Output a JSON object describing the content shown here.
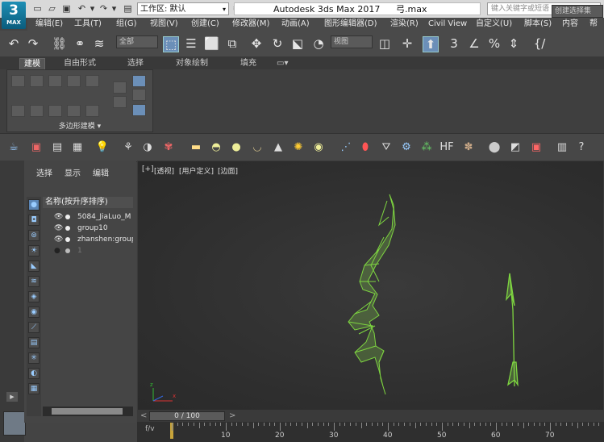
{
  "titlebar": {
    "logo_number": "3",
    "logo_sub": "MAX",
    "workspace_label": "工作区: 默认",
    "app_name": "Autodesk 3ds Max 2017",
    "file_name": "弓.max",
    "search_placeholder": "键入关键字或短语"
  },
  "menu": {
    "items": [
      "编辑(E)",
      "工具(T)",
      "组(G)",
      "视图(V)",
      "创建(C)",
      "修改器(M)",
      "动画(A)",
      "图形编辑器(D)",
      "渲染(R)",
      "Civil View",
      "自定义(U)",
      "脚本(S)",
      "内容",
      "帮助"
    ]
  },
  "main_toolbar": {
    "filter_select": "全部",
    "ref_coord_select": "视图",
    "selection_set_placeholder": "创建选择集"
  },
  "ribbon": {
    "tabs": [
      "建模",
      "自由形式",
      "选择",
      "对象绘制",
      "填充"
    ],
    "panel_label": "多边形建模 ▾"
  },
  "scene_explorer": {
    "menus": [
      "选择",
      "显示",
      "编辑"
    ],
    "header": "名称(按升序排序)",
    "rows": [
      {
        "name": "5084_JiaLuo_M"
      },
      {
        "name": "group10"
      },
      {
        "name": "zhanshen:group"
      },
      {
        "name": "1"
      }
    ]
  },
  "viewport": {
    "labels": [
      "[+]",
      "[透视]",
      "[用户定义]",
      "[边面]"
    ],
    "mesh_color": "#8fdf4a"
  },
  "timeline": {
    "slider_text": "0 / 100",
    "ticks": [
      "10",
      "20",
      "30",
      "40",
      "50",
      "60",
      "70"
    ]
  },
  "colors": {
    "accent": "#1d8fb5",
    "active_tool": "#6b8fb8",
    "wire_green": "#8fdf4a"
  }
}
